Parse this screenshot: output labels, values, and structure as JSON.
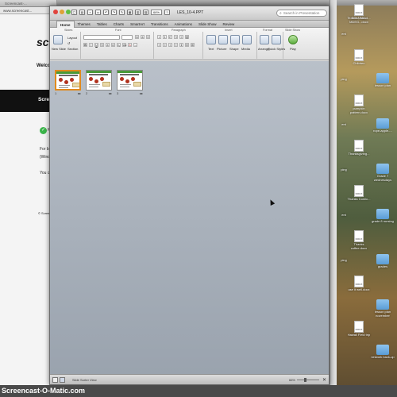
{
  "background_browser": {
    "tab_title": "Screencast-...",
    "url": "www.screencast...",
    "site_logo": "scre",
    "welcome": "Welco",
    "band_text": "Scre",
    "check_label": "F",
    "line1": "For b",
    "line2": "(Wind",
    "line3": "You c",
    "copyright": "© Screen"
  },
  "ppt": {
    "window_title": "LES_10-4.PPT",
    "zoom": "66%",
    "search_placeholder": "Search in Presentation",
    "ribbon_tabs": [
      "Home",
      "Themes",
      "Tables",
      "Charts",
      "SmartArt",
      "Transitions",
      "Animations",
      "Slide Show",
      "Review"
    ],
    "active_tab": "Home",
    "groups": {
      "slides": "Slides",
      "font": "Font",
      "paragraph": "Paragraph",
      "insert": "Insert",
      "format": "Format",
      "slide_show": "Slide Show"
    },
    "buttons": {
      "new_slide": "New Slide",
      "layout": "Layout",
      "section": "Section",
      "text": "Text",
      "picture": "Picture",
      "shape": "Shape",
      "media": "Media",
      "arrange": "Arrange",
      "quick_styles": "Quick Styles",
      "play": "Play"
    },
    "slides": [
      {
        "number": "1",
        "selected": true
      },
      {
        "number": "2",
        "selected": false
      },
      {
        "number": "3",
        "selected": false
      }
    ],
    "status_view": "Slide Sorter View",
    "status_zoom": "66%"
  },
  "desktop": {
    "icons": [
      {
        "label": "Teacher, Hand...",
        "type": "doc"
      },
      {
        "label": "SOLNMU-MDEG...docx",
        "type": "doc"
      },
      {
        "label": "lesson plan",
        "type": "folder"
      },
      {
        "label": "Children",
        "type": "doc"
      },
      {
        "label": "rope-apple-...",
        "type": "folder"
      },
      {
        "label": "pumpkin pattern.docx",
        "type": "doc"
      },
      {
        "label": "Grade 7 wednesdays",
        "type": "folder"
      },
      {
        "label": "Thanksgiving...",
        "type": "doc"
      },
      {
        "label": "grade 8 nursing",
        "type": "folder"
      },
      {
        "label": "Thanks Comic...",
        "type": "doc"
      },
      {
        "label": "grades",
        "type": "folder"
      },
      {
        "label": "Thanks coffee.docx",
        "type": "doc"
      },
      {
        "label": "lesson plan november",
        "type": "folder"
      },
      {
        "label": "use it well.docx",
        "type": "doc"
      },
      {
        "label": "network back-up",
        "type": "folder"
      },
      {
        "label": "Hawaii Field trip",
        "type": "doc"
      },
      {
        "label": "Pepsi resources",
        "type": "folder"
      }
    ],
    "left_strip_labels": [
      "ent",
      "ping",
      "ent",
      "ping",
      "ent",
      "ping"
    ]
  },
  "watermark": "Screencast-O-Matic.com"
}
